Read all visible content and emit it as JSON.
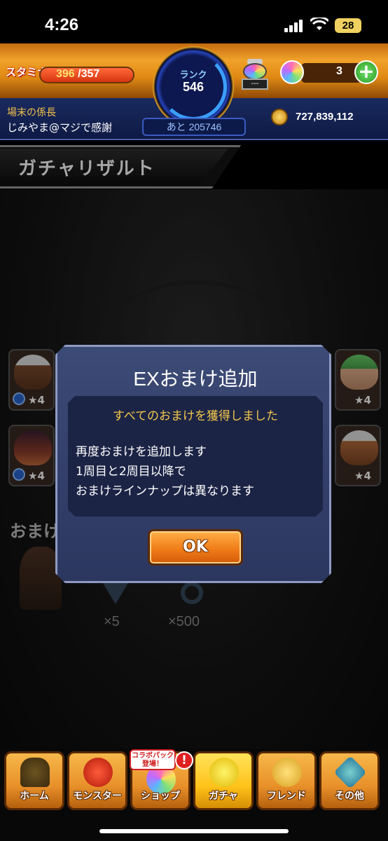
{
  "status_bar": {
    "time": "4:26",
    "battery": "28"
  },
  "header": {
    "stamina_label": "スタミナ",
    "stamina_current": "396",
    "stamina_max": "/357",
    "stamina_fill": 1.0,
    "rank_label": "ランク",
    "rank_value": "546",
    "rank_next": "あと 205746",
    "potion_value": "---",
    "orb_count": "3",
    "plus_symbol": "+",
    "title_label": "場末の係長",
    "username": "じみやま@マジで感謝",
    "gold": "727,839,112"
  },
  "page": {
    "title": "ガチャリザルト"
  },
  "background": {
    "omake_heading": "おまけ",
    "cards": [
      {
        "stars": "★4"
      },
      {
        "stars": "★4"
      },
      {
        "stars": "★4"
      },
      {
        "stars": "★4"
      }
    ],
    "rewards": [
      {
        "label": "×5"
      },
      {
        "label": "×500"
      }
    ]
  },
  "modal": {
    "title": "EXおまけ追加",
    "subtitle": "すべてのおまけを獲得しました",
    "body_lines": [
      "再度おまけを追加します",
      "1周目と2周目以降で",
      "おまけラインナップは異なります"
    ],
    "ok_label": "OK"
  },
  "bottom_nav": {
    "items": [
      {
        "label": "ホーム",
        "icon": "home-icon"
      },
      {
        "label": "モンスター",
        "icon": "monster-icon"
      },
      {
        "label": "ショップ",
        "icon": "shop-icon"
      },
      {
        "label": "ガチャ",
        "icon": "gacha-icon"
      },
      {
        "label": "フレンド",
        "icon": "friend-icon"
      },
      {
        "label": "その他",
        "icon": "other-icon"
      }
    ],
    "collab_badge": "コラボパック登場！",
    "alert_badge": "!"
  },
  "colors": {
    "header_orange": "#f0a22a",
    "header_navy": "#1a2a60",
    "modal_bg": "#3c4a76",
    "accent_yellow": "#f4c84a",
    "ok_orange": "#f07d18"
  }
}
